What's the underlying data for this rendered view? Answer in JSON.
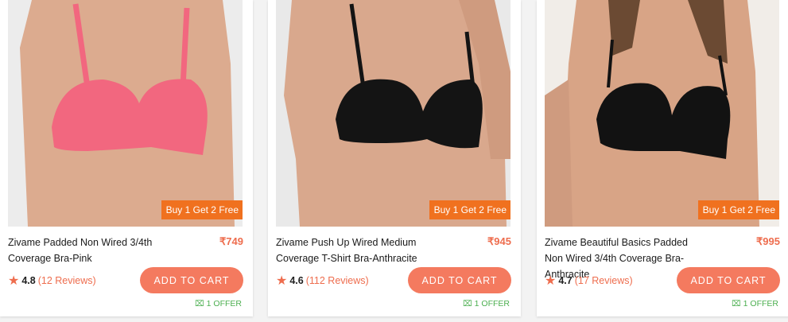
{
  "products": [
    {
      "title": "Zivame Push Up Wired Medium Coverage T-Shirt Bra-Anthracite",
      "price": "₹945",
      "promo": "Buy 1 Get 2 Free",
      "rating": "4.6",
      "reviews": "(112 Reviews)",
      "cart_label": "ADD TO CART",
      "offer": "1 OFFER",
      "bra_color": "#141414",
      "bg_color": "#e9e9e9",
      "skin_color": "#d9a88d"
    },
    {
      "title": "Zivame Beautiful Basics Padded Non Wired 3/4th Coverage Bra-Anthracite",
      "price": "₹995",
      "promo": "Buy 1 Get 2 Free",
      "rating": "4.7",
      "reviews": "(17 Reviews)",
      "cart_label": "ADD TO CART",
      "offer": "1 OFFER",
      "bra_color": "#121212",
      "bg_color": "#f1ede8",
      "skin_color": "#d8a486"
    },
    {
      "title": "Zivame Padded Non Wired 3/4th Coverage Bra-Pink",
      "price": "₹749",
      "promo": "Buy 1 Get 2 Free",
      "rating": "4.8",
      "reviews": "(12 Reviews)",
      "cart_label": "ADD TO CART",
      "offer": "1 OFFER",
      "bra_color": "#f2677f",
      "bg_color": "#ececec",
      "skin_color": "#dcab8f"
    }
  ]
}
